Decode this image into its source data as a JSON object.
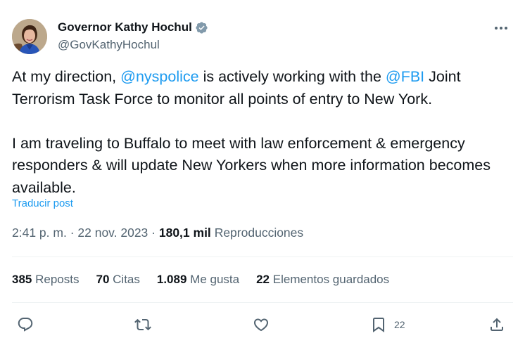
{
  "author": {
    "display_name": "Governor Kathy Hochul",
    "handle": "@GovKathyHochul",
    "verified_icon": "verified-badge-icon"
  },
  "tweet": {
    "para1": {
      "part1": "At my direction, ",
      "mention1": "@nyspolice",
      "part2": " is actively working with the ",
      "mention2": "@FBI",
      "part3": " Joint Terrorism Task Force to monitor all points of entry to New York."
    },
    "para2": "I am traveling to Buffalo to meet with law enforcement & emergency responders & will update New Yorkers when more information becomes available.",
    "translate_label": "Traducir post"
  },
  "meta": {
    "time": "2:41 p. m.",
    "sep1": " · ",
    "date": "22 nov. 2023",
    "sep2": " · ",
    "views": "180,1 mil",
    "views_label": "Reproducciones"
  },
  "stats": {
    "reposts": {
      "count": "385",
      "label": "Reposts"
    },
    "quotes": {
      "count": "70",
      "label": "Citas"
    },
    "likes": {
      "count": "1.089",
      "label": "Me gusta"
    },
    "bookmarks": {
      "count": "22",
      "label": "Elementos guardados"
    }
  },
  "actions": {
    "reply_icon": "reply-icon",
    "repost_icon": "repost-icon",
    "like_icon": "like-icon",
    "bookmark_icon": "bookmark-icon",
    "bookmark_count": "22",
    "share_icon": "share-icon"
  },
  "colors": {
    "accent": "#1d9bf0",
    "secondary_text": "#536471",
    "primary_text": "#0f1419",
    "divider": "#eff3f4"
  }
}
